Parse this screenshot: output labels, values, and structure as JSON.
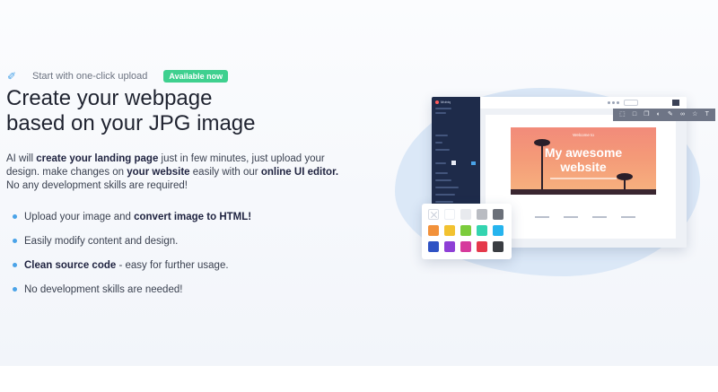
{
  "hero": {
    "eyebrow_text": "Start with one-click upload",
    "badge": "Available now",
    "headline_line1": "Create your webpage",
    "headline_line2": "based on your JPG image",
    "intro": {
      "p1": "AI will ",
      "b1": "create your landing page",
      "p2": " just in few minutes, just upload your design. make changes on ",
      "b2": "your website",
      "p3": " easily with our ",
      "b3": "online UI editor.",
      "p4": " No any development skills are required!"
    },
    "features": [
      {
        "pre": "Upload your image and ",
        "bold": "convert image to HTML!",
        "post": ""
      },
      {
        "pre": "Easily modify content and design.",
        "bold": "",
        "post": ""
      },
      {
        "pre": "",
        "bold": "Clean source code",
        "post": " - easy for further usage."
      },
      {
        "pre": "No development skills are needed!",
        "bold": "",
        "post": ""
      }
    ]
  },
  "mockup": {
    "editor_logo": "Mobiq",
    "hero_welcome": "Welcome to",
    "hero_title_line1": "My awesome",
    "hero_title_line2": "website",
    "toolbar_icons": [
      "select-icon",
      "layout-icon",
      "copy-icon",
      "paint-icon",
      "brush-icon",
      "link-icon",
      "star-icon",
      "text-icon"
    ],
    "palette_colors": [
      "none",
      "#ffffff",
      "#e8eaee",
      "#b9bcc2",
      "#6b7079",
      "#f2913a",
      "#f2c230",
      "#7ccc3c",
      "#34d4b0",
      "#26b4ee",
      "#2f52c4",
      "#8e3fd6",
      "#d63a9c",
      "#e5394b",
      "#3a3d42"
    ]
  },
  "colors": {
    "accent": "#4aa3e8",
    "badge": "#3fd08f",
    "editor_sidebar": "#1e2b4a"
  }
}
